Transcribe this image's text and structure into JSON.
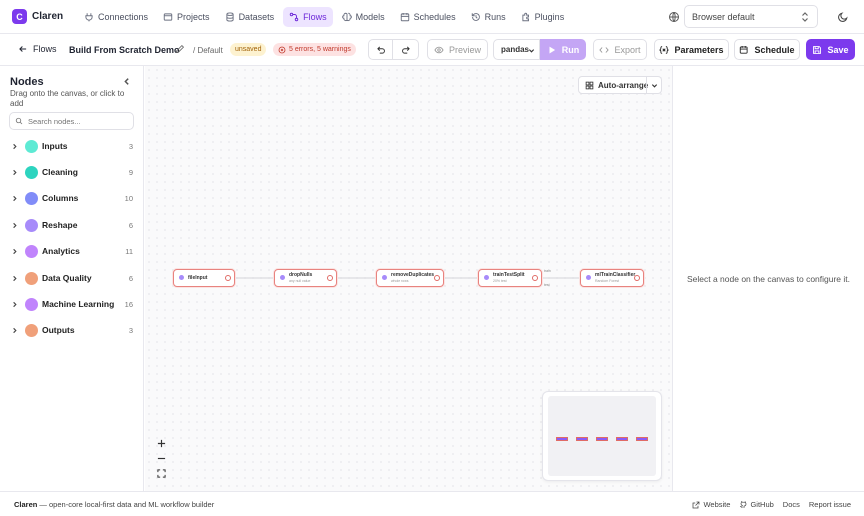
{
  "app": {
    "name": "Claren",
    "logo_letter": "C"
  },
  "nav": {
    "items": [
      {
        "label": "Connections",
        "icon": "plug-icon",
        "active": false
      },
      {
        "label": "Projects",
        "icon": "folder-icon",
        "active": false
      },
      {
        "label": "Datasets",
        "icon": "database-icon",
        "active": false
      },
      {
        "label": "Flows",
        "icon": "flow-icon",
        "active": true
      },
      {
        "label": "Models",
        "icon": "models-icon",
        "active": false
      },
      {
        "label": "Schedules",
        "icon": "calendar-icon",
        "active": false
      },
      {
        "label": "Runs",
        "icon": "history-icon",
        "active": false
      },
      {
        "label": "Plugins",
        "icon": "plugin-icon",
        "active": false
      }
    ],
    "language": "Browser default"
  },
  "toolbar": {
    "back_label": "Flows",
    "flow_title": "Build From Scratch Demo",
    "breadcrumb": "/ Default",
    "unsaved_badge": "unsaved",
    "errors_badge": "5 errors, 5 warnings",
    "preview_label": "Preview",
    "engine": "pandas",
    "run_label": "Run",
    "export_label": "Export",
    "parameters_label": "Parameters",
    "schedule_label": "Schedule",
    "save_label": "Save"
  },
  "sidebar": {
    "title": "Nodes",
    "subtitle": "Drag onto the canvas, or click to add",
    "search_placeholder": "Search nodes...",
    "categories": [
      {
        "label": "Inputs",
        "count": "3",
        "color": "#5eead4"
      },
      {
        "label": "Cleaning",
        "count": "9",
        "color": "#2dd4bf"
      },
      {
        "label": "Columns",
        "count": "10",
        "color": "#818cf8"
      },
      {
        "label": "Reshape",
        "count": "6",
        "color": "#a78bfa"
      },
      {
        "label": "Analytics",
        "count": "11",
        "color": "#c084fc"
      },
      {
        "label": "Data Quality",
        "count": "6",
        "color": "#f0a07a"
      },
      {
        "label": "Machine Learning",
        "count": "16",
        "color": "#c084fc"
      },
      {
        "label": "Outputs",
        "count": "3",
        "color": "#f0a07a"
      }
    ]
  },
  "canvas": {
    "auto_arrange_label": "Auto-arrange",
    "nodes": [
      {
        "label": "fileInput",
        "sub": ""
      },
      {
        "label": "dropNulls",
        "sub": "any null value"
      },
      {
        "label": "removeDuplicates",
        "sub": "whole rows"
      },
      {
        "label": "trainTestSplit",
        "sub": "20% test"
      },
      {
        "label": "mlTrainClassifier",
        "sub": "Random Forest"
      }
    ],
    "edge_labels": {
      "train": "train",
      "test": "test"
    }
  },
  "inspector": {
    "empty_message": "Select a node on the canvas to configure it."
  },
  "footer": {
    "brand": "Claren",
    "tagline": " — open-core local-first data and ML workflow builder",
    "links": {
      "website": "Website",
      "github": "GitHub",
      "docs": "Docs",
      "report": "Report issue"
    }
  },
  "colors": {
    "accent": "#7c3aed",
    "accent_light": "#ede4ff",
    "error": "#e8837f"
  }
}
